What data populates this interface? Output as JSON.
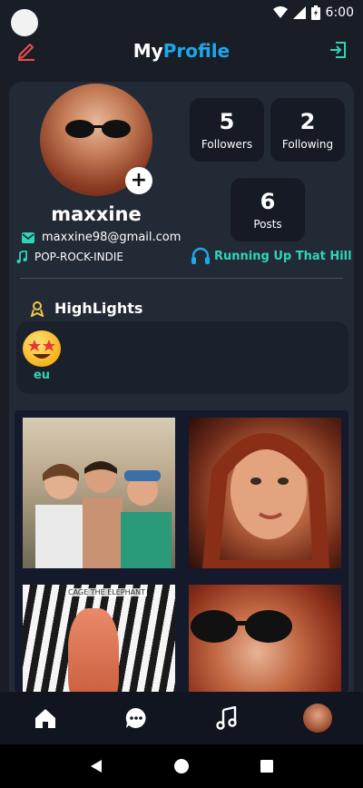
{
  "status_bar": {
    "time": "6:00"
  },
  "header": {
    "title_part1": "My",
    "title_part2": "Profile"
  },
  "profile": {
    "username": "maxxine",
    "email": "maxxine98@gmail.com",
    "genres": "POP-ROCK-INDIE",
    "song": "Running Up That Hill"
  },
  "stats": {
    "followers": {
      "value": "5",
      "label": "Followers"
    },
    "following": {
      "value": "2",
      "label": "Following"
    },
    "posts": {
      "value": "6",
      "label": "Posts"
    }
  },
  "highlights": {
    "title": "HighLights",
    "items": [
      {
        "label": "eu"
      }
    ]
  },
  "posts_grid": {
    "tile3_caption": "CAGE THE ELEPHANT"
  },
  "icons": {
    "edit": "edit-icon",
    "logout": "logout-icon",
    "email": "email-icon",
    "music_note": "music-note-icon",
    "headphones": "headphones-icon",
    "highlight": "highlight-icon",
    "home": "home-icon",
    "chat": "chat-icon",
    "music": "music-icon"
  },
  "colors": {
    "accent_blue": "#1ea7e8",
    "accent_teal": "#2fd5b6",
    "edit_red": "#e84e4e",
    "highlight_yellow": "#f2c94c",
    "background": "#181d26",
    "card": "#222a36"
  }
}
